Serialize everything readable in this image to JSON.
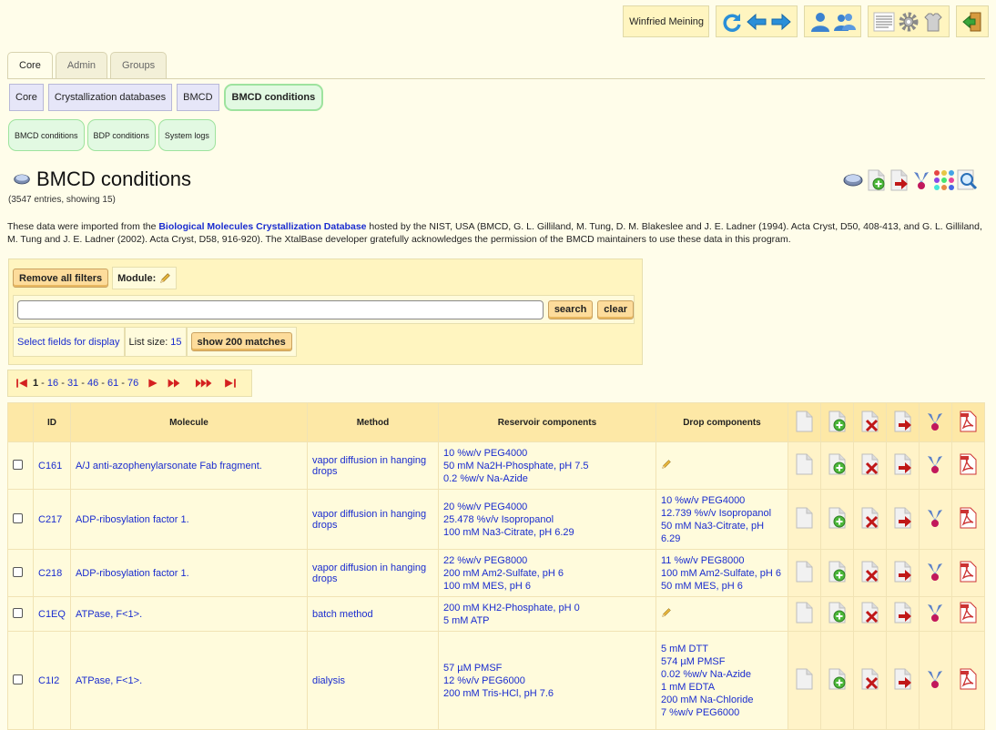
{
  "user": {
    "name": "Winfried Meining"
  },
  "tabs": [
    {
      "label": "Core",
      "active": true
    },
    {
      "label": "Admin",
      "active": false
    },
    {
      "label": "Groups",
      "active": false
    }
  ],
  "breadcrumbs": [
    {
      "label": "Core",
      "active": false
    },
    {
      "label": "Crystallization databases",
      "active": false
    },
    {
      "label": "BMCD",
      "active": false
    },
    {
      "label": "BMCD conditions",
      "active": true
    }
  ],
  "subnav": [
    {
      "label": "BMCD conditions"
    },
    {
      "label": "BDP conditions"
    },
    {
      "label": "System logs"
    }
  ],
  "page": {
    "title": "BMCD conditions",
    "count": "(3547 entries, showing 15)",
    "description_pre": "These data were imported from the ",
    "description_link": "Biological Molecules Crystallization Database",
    "description_post": " hosted by the NIST, USA (BMCD, G. L. Gilliland, M. Tung, D. M. Blakeslee and J. E. Ladner (1994). Acta Cryst, D50, 408-413, and G. L. Gilliland, M. Tung and J. E. Ladner (2002). Acta Cryst, D58, 916-920). The XtalBase developer gratefully acknowledges the permission of the BMCD maintainers to use these data in this program."
  },
  "filter": {
    "remove_label": "Remove all filters",
    "module_label": "Module:",
    "search_value": "",
    "search_label": "search",
    "clear_label": "clear",
    "select_fields_label": "Select fields for display",
    "list_size_label": "List size:",
    "list_size_value": "15",
    "show_matches_label": "show 200 matches"
  },
  "pager": {
    "current": "1",
    "pages": [
      "16",
      "31",
      "46",
      "61",
      "76"
    ]
  },
  "table": {
    "headers": {
      "id": "ID",
      "molecule": "Molecule",
      "method": "Method",
      "reservoir": "Reservoir components",
      "drop": "Drop components"
    },
    "rows": [
      {
        "id": "C161",
        "molecule": "A/J anti-azophenylarsonate Fab fragment.",
        "method": "vapor diffusion in hanging drops",
        "reservoir": [
          "10 %w/v PEG4000",
          "50 mM Na2H-Phosphate, pH 7.5",
          "0.2 %w/v Na-Azide"
        ],
        "drop": [],
        "drop_edit": true
      },
      {
        "id": "C217",
        "molecule": "ADP-ribosylation factor 1.",
        "method": "vapor diffusion in hanging drops",
        "reservoir": [
          "20 %w/v PEG4000",
          "25.478 %v/v Isopropanol",
          "100 mM Na3-Citrate, pH 6.29"
        ],
        "drop": [
          "10 %w/v PEG4000",
          "12.739 %v/v Isopropanol",
          "50 mM Na3-Citrate, pH 6.29"
        ],
        "drop_edit": false
      },
      {
        "id": "C218",
        "molecule": "ADP-ribosylation factor 1.",
        "method": "vapor diffusion in hanging drops",
        "reservoir": [
          "22 %w/v PEG8000",
          "200 mM Am2-Sulfate, pH 6",
          "100 mM MES, pH 6"
        ],
        "drop": [
          "11 %w/v PEG8000",
          "100 mM Am2-Sulfate, pH 6",
          "50 mM MES, pH 6"
        ],
        "drop_edit": false
      },
      {
        "id": "C1EQ",
        "molecule": "ATPase, F<1>.",
        "method": "batch method",
        "reservoir": [
          "200 mM KH2-Phosphate, pH 0",
          "5 mM ATP"
        ],
        "drop": [],
        "drop_edit": true
      },
      {
        "id": "C1I2",
        "molecule": "ATPase, F<1>.",
        "method": "dialysis",
        "reservoir": [
          "57 µM PMSF",
          "12 %v/v PEG6000",
          "200 mM Tris-HCl, pH 7.6"
        ],
        "drop": [
          "5 mM DTT",
          "574 µM PMSF",
          "0.02 %w/v Na-Azide",
          "1 mM EDTA",
          "200 mM Na-Chloride",
          "7 %w/v PEG6000"
        ],
        "drop_edit": false
      }
    ]
  },
  "colors": {
    "background": "#fffdea",
    "panel": "#fff5c0",
    "header": "#fde8a6",
    "link": "#1a2ccf",
    "button": "#fddc9b"
  }
}
